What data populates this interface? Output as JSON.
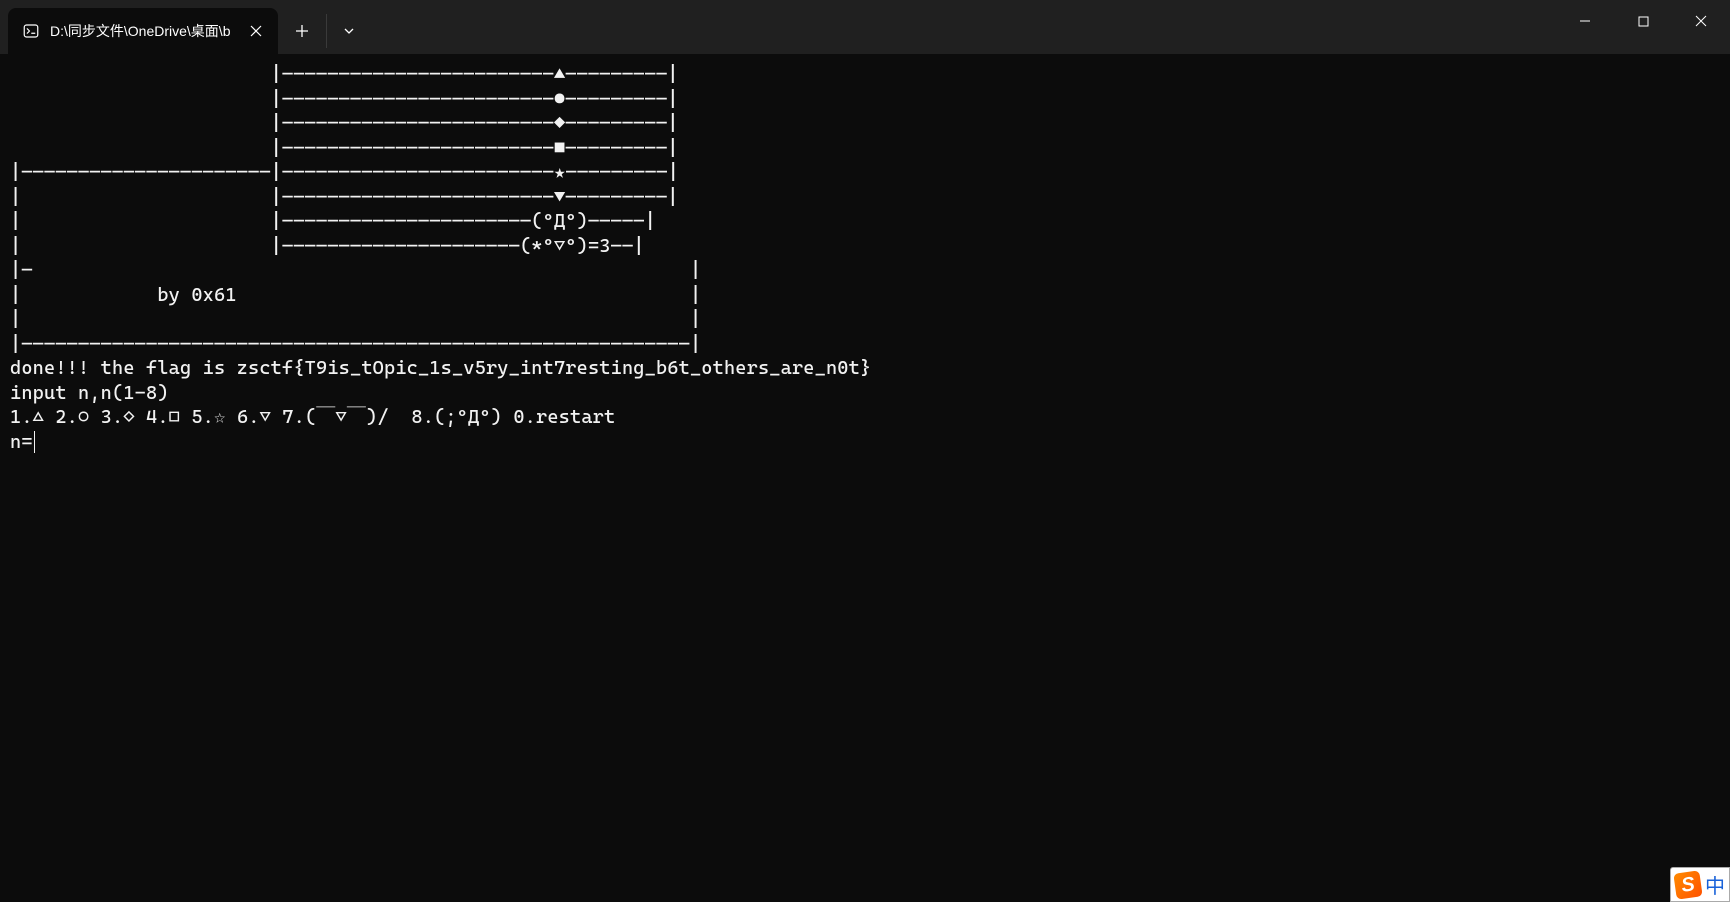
{
  "titlebar": {
    "tab_title": "D:\\同步文件\\OneDrive\\桌面\\b",
    "close_tab": "×",
    "new_tab": "+",
    "dropdown": "⌄"
  },
  "terminal": {
    "ascii_art": "                       |————————————————————————▲—————————|\n                       |————————————————————————●—————————|\n                       |————————————————————————◆—————————|\n                       |————————————————————————■—————————|\n|——————————————————————|————————————————————————★—————————|\n|                      |————————————————————————▼—————————|\n|                      |——————————————————————(ºДº)—————|\n|                      |—————————————————————(*º▽º)=3——|\n|—                                                          |\n|            by 0x61                                        |\n|                                                           |\n|———————————————————————————————————————————————————————————|",
    "line_done": "done!!! the flag is zsctf{T9is_tOpic_1s_v5ry_int7resting_b6t_others_are_n0t}",
    "line_input_prompt": "input n,n(1-8)",
    "line_options": "1.△ 2.○ 3.◇ 4.□ 5.☆ 6.▽ 7.(￣▽￣)/  8.(;ºДº) 0.restart",
    "line_cursor": "n="
  },
  "ime": {
    "logo_letter": "S",
    "lang": "中"
  }
}
